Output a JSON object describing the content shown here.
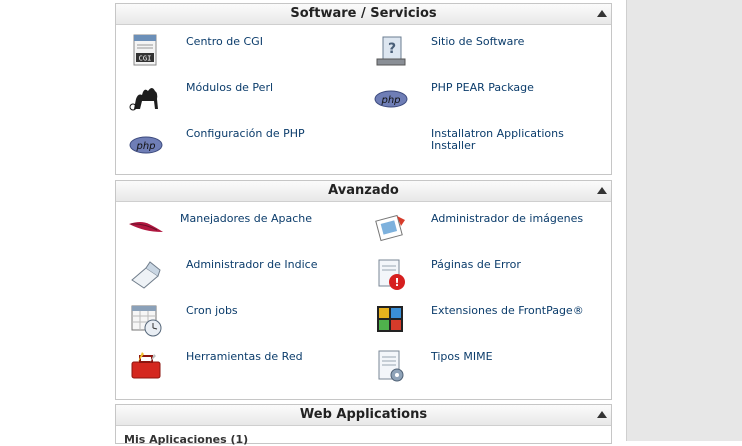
{
  "sections": {
    "software": {
      "title": "Software / Servicios",
      "items": [
        {
          "label": "Centro de CGI",
          "icon": "cgi-script-icon"
        },
        {
          "label": "Sitio de Software",
          "icon": "software-site-icon"
        },
        {
          "label": "Módulos de Perl",
          "icon": "perl-camel-icon"
        },
        {
          "label": "PHP PEAR Package",
          "icon": "php-pear-icon"
        },
        {
          "label": "Configuración de PHP",
          "icon": "php-config-icon"
        },
        {
          "label": "Installatron Applications Installer",
          "icon": "installatron-icon"
        }
      ]
    },
    "avanzado": {
      "title": "Avanzado",
      "items": [
        {
          "label": "Manejadores de Apache",
          "icon": "apache-feather-icon"
        },
        {
          "label": "Administrador de imágenes",
          "icon": "image-manager-icon"
        },
        {
          "label": "Administrador de Indice",
          "icon": "index-manager-icon"
        },
        {
          "label": "Páginas de Error",
          "icon": "error-pages-icon"
        },
        {
          "label": "Cron jobs",
          "icon": "cron-calendar-icon"
        },
        {
          "label": "Extensiones de FrontPage®",
          "icon": "frontpage-icon"
        },
        {
          "label": "Herramientas de Red",
          "icon": "network-toolbox-icon"
        },
        {
          "label": "Tipos MIME",
          "icon": "mime-types-icon"
        }
      ]
    },
    "webapps": {
      "title": "Web Applications",
      "partial_text": "Mis Aplicaciones (1)"
    }
  }
}
